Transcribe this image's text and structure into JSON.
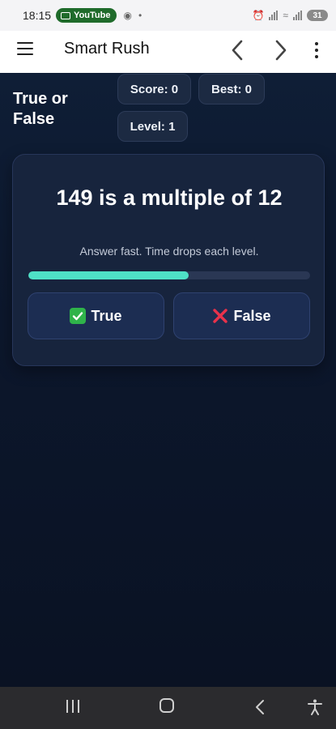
{
  "status_bar": {
    "time": "18:15",
    "youtube_label": "YouTube",
    "battery": "31"
  },
  "app_bar": {
    "title": "Smart Rush"
  },
  "game": {
    "title": "True or False",
    "score_label": "Score: 0",
    "best_label": "Best: 0",
    "level_label": "Level: 1",
    "question": "149 is a multiple of 12",
    "hint": "Answer fast. Time drops each level.",
    "timer_remaining_fraction": 0.57,
    "true_label": "True",
    "false_label": "False"
  },
  "colors": {
    "accent": "#4ee0c6",
    "card": "#17243d",
    "background": "#0b1426"
  },
  "icons": {
    "true_icon": "check-box-icon",
    "false_icon": "cross-mark-icon"
  }
}
